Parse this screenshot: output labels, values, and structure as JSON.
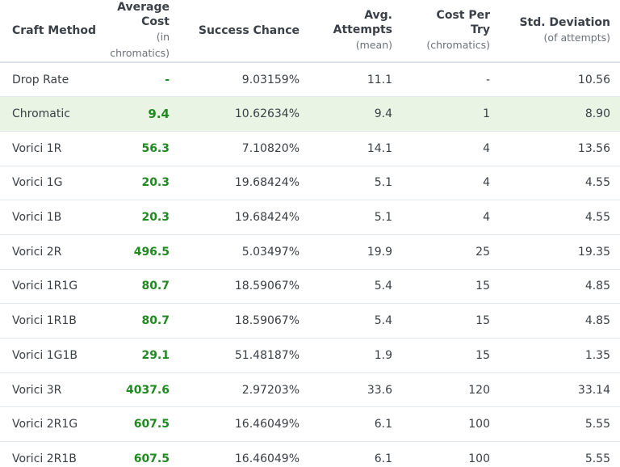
{
  "header": {
    "craft_method": "Craft Method",
    "average_cost": "Average Cost",
    "average_cost_sub": "(in chromatics)",
    "success_chance": "Success Chance",
    "avg_attempts": "Avg. Attempts",
    "avg_attempts_sub": "(mean)",
    "cost_per_try": "Cost Per Try",
    "cost_per_try_sub": "(chromatics)",
    "std_deviation": "Std. Deviation",
    "std_deviation_sub": "(of attempts)"
  },
  "rows": [
    {
      "method": "Drop Rate",
      "cost": "-",
      "chance": "9.03159%",
      "attempts": "11.1",
      "cost_per_try": "-",
      "std_dev": "10.56"
    },
    {
      "method": "Chromatic",
      "cost": "9.4",
      "chance": "10.62634%",
      "attempts": "9.4",
      "cost_per_try": "1",
      "std_dev": "8.90"
    },
    {
      "method": "Vorici 1R",
      "cost": "56.3",
      "chance": "7.10820%",
      "attempts": "14.1",
      "cost_per_try": "4",
      "std_dev": "13.56"
    },
    {
      "method": "Vorici 1G",
      "cost": "20.3",
      "chance": "19.68424%",
      "attempts": "5.1",
      "cost_per_try": "4",
      "std_dev": "4.55"
    },
    {
      "method": "Vorici 1B",
      "cost": "20.3",
      "chance": "19.68424%",
      "attempts": "5.1",
      "cost_per_try": "4",
      "std_dev": "4.55"
    },
    {
      "method": "Vorici 2R",
      "cost": "496.5",
      "chance": "5.03497%",
      "attempts": "19.9",
      "cost_per_try": "25",
      "std_dev": "19.35"
    },
    {
      "method": "Vorici 1R1G",
      "cost": "80.7",
      "chance": "18.59067%",
      "attempts": "5.4",
      "cost_per_try": "15",
      "std_dev": "4.85"
    },
    {
      "method": "Vorici 1R1B",
      "cost": "80.7",
      "chance": "18.59067%",
      "attempts": "5.4",
      "cost_per_try": "15",
      "std_dev": "4.85"
    },
    {
      "method": "Vorici 1G1B",
      "cost": "29.1",
      "chance": "51.48187%",
      "attempts": "1.9",
      "cost_per_try": "15",
      "std_dev": "1.35"
    },
    {
      "method": "Vorici 3R",
      "cost": "4037.6",
      "chance": "2.97203%",
      "attempts": "33.6",
      "cost_per_try": "120",
      "std_dev": "33.14"
    },
    {
      "method": "Vorici 2R1G",
      "cost": "607.5",
      "chance": "16.46049%",
      "attempts": "6.1",
      "cost_per_try": "100",
      "std_dev": "5.55"
    },
    {
      "method": "Vorici 2R1B",
      "cost": "607.5",
      "chance": "16.46049%",
      "attempts": "6.1",
      "cost_per_try": "100",
      "std_dev": "5.55"
    }
  ],
  "highlight_row": "Chromatic",
  "colors": {
    "cost_text": "#1f8a1f",
    "highlight_bg": "#e9f4e4"
  }
}
